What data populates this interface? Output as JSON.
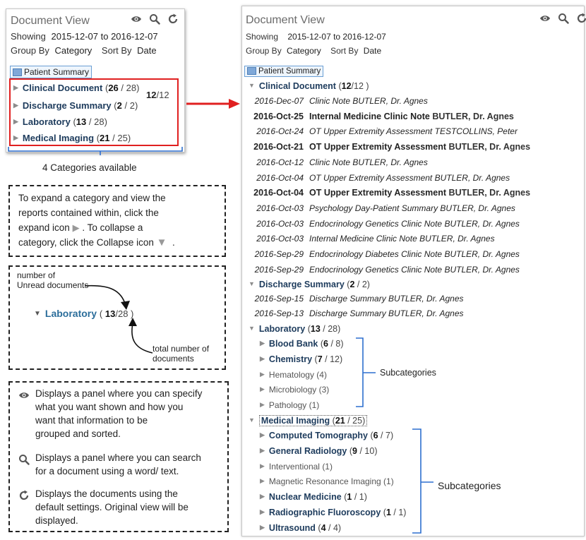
{
  "small_panel": {
    "title": "Document View",
    "showing_label": "Showing",
    "showing_value": "2015-12-07 to 2016-12-07",
    "group_label": "Group By",
    "group_value": "Category",
    "sort_label": "Sort By",
    "sort_value": "Date",
    "patient_summary": "Patient Summary",
    "categories": [
      {
        "name": "Clinical Document",
        "unread": "26",
        "total": "28"
      },
      {
        "name": "Discharge Summary",
        "unread": "2",
        "total": "2"
      },
      {
        "name": "Laboratory",
        "unread": "13",
        "total": "28"
      },
      {
        "name": "Medical Imaging",
        "unread": "21",
        "total": "25"
      }
    ],
    "overlap_unread": "12",
    "overlap_total": "12",
    "categories_caption": "4 Categories available"
  },
  "expand_note": {
    "line1": "To expand a category and view the",
    "line2": "reports contained within, click the",
    "line3a": "expand icon",
    "line3b": ". To collapse a",
    "line4": "category, click the Collapse icon",
    "line4b": "."
  },
  "count_note": {
    "unread_label_1": "number of",
    "unread_label_2": "Unread documents",
    "category": "Laboratory",
    "unread": "13",
    "total": "28",
    "total_label_1": "total number of",
    "total_label_2": "documents"
  },
  "icon_note": {
    "eye_line1": "Displays a panel where you can specify",
    "eye_line2": "what you want shown and how you",
    "eye_line3": "want that information to be",
    "eye_line4": "grouped and sorted.",
    "search_line1": "Displays a panel where you can search",
    "search_line2": "for a document using a word/ text.",
    "refresh_line1": "Displays the documents using the",
    "refresh_line2": "default settings. Original view will be",
    "refresh_line3": "displayed."
  },
  "big_panel": {
    "title": "Document View",
    "showing_label": "Showing",
    "showing_value": "2015-12-07 to 2016-12-07",
    "group_label": "Group By",
    "group_value": "Category",
    "sort_label": "Sort By",
    "sort_value": "Date",
    "patient_summary": "Patient Summary",
    "clinical": {
      "name": "Clinical Document",
      "unread": "12",
      "total": "12",
      "docs": [
        {
          "date": "2016-Dec-07",
          "title": "Clinic Note",
          "author": "BUTLER, Dr. Agnes",
          "unread": false
        },
        {
          "date": "2016-Oct-25",
          "title": "Internal Medicine Clinic Note",
          "author": "BUTLER, Dr. Agnes",
          "unread": true
        },
        {
          "date": "2016-Oct-24",
          "title": "OT Upper Extremity Assessment",
          "author": "TESTCOLLINS, Peter",
          "unread": false
        },
        {
          "date": "2016-Oct-21",
          "title": "OT Upper Extremity Assessment",
          "author": "BUTLER, Dr. Agnes",
          "unread": true
        },
        {
          "date": "2016-Oct-12",
          "title": "Clinic Note",
          "author": "BUTLER, Dr. Agnes",
          "unread": false
        },
        {
          "date": "2016-Oct-04",
          "title": "OT Upper Extremity Assessment",
          "author": "BUTLER, Dr. Agnes",
          "unread": false
        },
        {
          "date": "2016-Oct-04",
          "title": "OT Upper Extremity Assessment",
          "author": "BUTLER, Dr. Agnes",
          "unread": true
        },
        {
          "date": "2016-Oct-03",
          "title": "Psychology Day-Patient Summary",
          "author": "BUTLER, Dr. Agnes",
          "unread": false
        },
        {
          "date": "2016-Oct-03",
          "title": "Endocrinology Genetics Clinic Note",
          "author": "BUTLER, Dr. Agnes",
          "unread": false
        },
        {
          "date": "2016-Oct-03",
          "title": "Internal Medicine Clinic Note",
          "author": "BUTLER, Dr. Agnes",
          "unread": false
        },
        {
          "date": "2016-Sep-29",
          "title": "Endocrinology Diabetes Clinic Note",
          "author": "BUTLER, Dr. Agnes",
          "unread": false
        },
        {
          "date": "2016-Sep-29",
          "title": "Endocrinology Genetics Clinic Note",
          "author": "BUTLER, Dr. Agnes",
          "unread": false
        }
      ]
    },
    "discharge": {
      "name": "Discharge Summary",
      "unread": "2",
      "total": "2",
      "docs": [
        {
          "date": "2016-Sep-15",
          "title": "Discharge Summary",
          "author": "BUTLER, Dr. Agnes",
          "unread": false
        },
        {
          "date": "2016-Sep-13",
          "title": "Discharge Summary",
          "author": "BUTLER, Dr. Agnes",
          "unread": false
        }
      ]
    },
    "laboratory": {
      "name": "Laboratory",
      "unread": "13",
      "total": "28",
      "subs": [
        {
          "name": "Blood Bank",
          "unread": "6",
          "total": "8",
          "bold": true
        },
        {
          "name": "Chemistry",
          "unread": "7",
          "total": "12",
          "bold": true
        },
        {
          "name": "Hematology",
          "count": "(4)",
          "bold": false
        },
        {
          "name": "Microbiology",
          "count": "(3)",
          "bold": false
        },
        {
          "name": "Pathology",
          "count": "(1)",
          "bold": false
        }
      ],
      "subcategories_label": "Subcategories"
    },
    "imaging": {
      "name": "Medical Imaging",
      "unread": "21",
      "total": "25",
      "subs": [
        {
          "name": "Computed Tomography",
          "unread": "6",
          "total": "7",
          "bold": true
        },
        {
          "name": "General Radiology",
          "unread": "9",
          "total": "10",
          "bold": true
        },
        {
          "name": "Interventional",
          "count": "(1)",
          "bold": false
        },
        {
          "name": "Magnetic Resonance Imaging",
          "count": "(1)",
          "bold": false
        },
        {
          "name": "Nuclear Medicine",
          "unread": "1",
          "total": "1",
          "bold": true
        },
        {
          "name": "Radiographic Fluoroscopy",
          "unread": "1",
          "total": "1",
          "bold": true
        },
        {
          "name": "Ultrasound",
          "unread": "4",
          "total": "4",
          "bold": true
        }
      ],
      "subcategories_label": "Subcategories"
    }
  }
}
